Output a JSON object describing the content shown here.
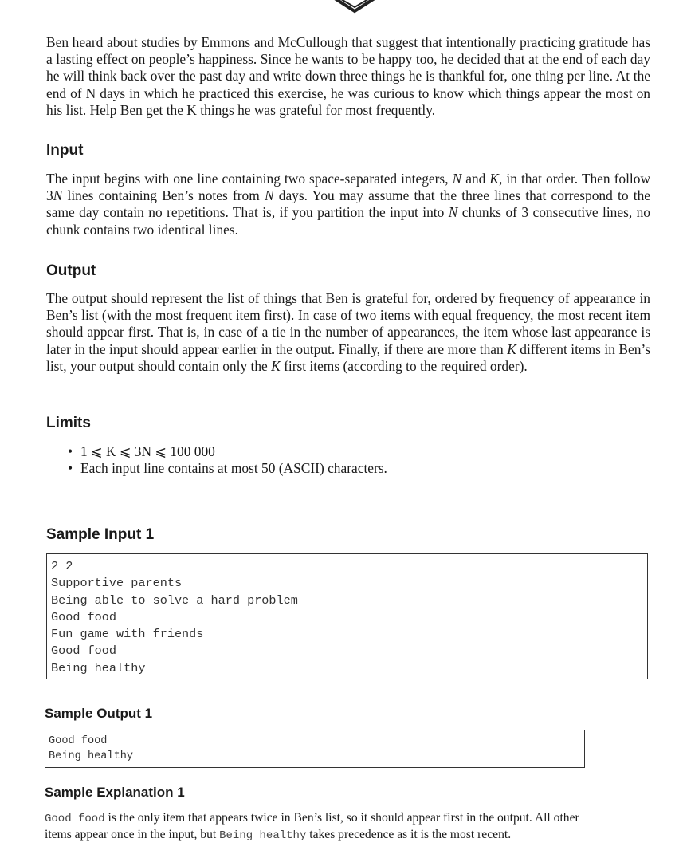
{
  "statement": {
    "intro": "Ben heard about studies by Emmons and McCullough that suggest that intentionally practicing gratitude has a lasting effect on people’s happiness. Since he wants to be happy too, he decided that at the end of each day he will think back over the past day and write down three things he is thankful for, one thing per line. At the end of N days in which he practiced this exercise, he was curious to know which things appear the most on his list. Help Ben get the K things he was grateful for most frequently."
  },
  "input_section": {
    "heading": "Input",
    "text_1": "The input begins with one line containing two space-separated integers, ",
    "var_n": "N",
    "text_2": " and ",
    "var_k": "K",
    "text_3": ", in that order. Then follow 3",
    "var_n2": "N",
    "text_4": " lines containing Ben’s notes from ",
    "var_n3": "N",
    "text_5": " days. You may assume that the three lines that correspond to the same day contain no repetitions. That is, if you partition the input into ",
    "var_n4": "N",
    "text_6": " chunks of 3 consecutive lines, no chunk contains two identical lines."
  },
  "output_section": {
    "heading": "Output",
    "text_1": "The output should represent the list of things that Ben is grateful for, ordered by frequency of appearance in Ben’s list (with the most frequent item first). In case of two items with equal frequency, the most recent item should appear first. That is, in case of a tie in the number of appearances, the item whose last appearance is later in the input should appear earlier in the output. Finally, if there are more than ",
    "var_k": "K",
    "text_2": " different items in Ben’s list, your output should contain only the ",
    "var_k2": "K",
    "text_3": " first items (according to the required order)."
  },
  "limits_section": {
    "heading": "Limits",
    "bullet": "•",
    "items": [
      "1 ⩽ K ⩽ 3N ⩽ 100 000",
      "Each input line contains at most 50 (ASCII) characters."
    ]
  },
  "sample_input": {
    "heading": "Sample Input 1",
    "lines": [
      "2 2",
      "Supportive parents",
      "Being able to solve a hard problem",
      "Good food",
      "Fun game with friends",
      "Good food",
      "Being healthy"
    ]
  },
  "sample_output": {
    "heading": "Sample Output 1",
    "lines": [
      "Good food",
      "Being healthy"
    ]
  },
  "sample_explanation": {
    "heading": "Sample Explanation 1",
    "code_1": "Good food",
    "text_1": " is the only item that appears twice in Ben’s list, so it should appear first in the output. All other items appear once in the input, but ",
    "code_2": "Being healthy",
    "text_2": " takes precedence as it is the most recent."
  }
}
